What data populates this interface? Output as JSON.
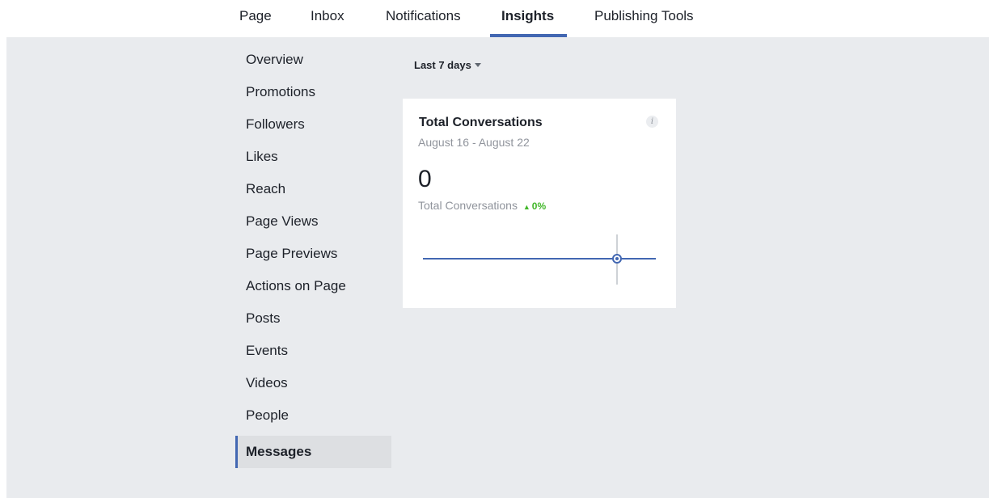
{
  "nav": {
    "tabs": [
      {
        "label": "Page"
      },
      {
        "label": "Inbox"
      },
      {
        "label": "Notifications"
      },
      {
        "label": "Insights"
      },
      {
        "label": "Publishing Tools"
      }
    ],
    "active": "Insights"
  },
  "sidebar": {
    "items": [
      {
        "label": "Overview"
      },
      {
        "label": "Promotions"
      },
      {
        "label": "Followers"
      },
      {
        "label": "Likes"
      },
      {
        "label": "Reach"
      },
      {
        "label": "Page Views"
      },
      {
        "label": "Page Previews"
      },
      {
        "label": "Actions on Page"
      },
      {
        "label": "Posts"
      },
      {
        "label": "Events"
      },
      {
        "label": "Videos"
      },
      {
        "label": "People"
      },
      {
        "label": "Messages"
      }
    ],
    "active": "Messages"
  },
  "filter": {
    "range_label": "Last 7 days"
  },
  "card": {
    "title": "Total Conversations",
    "date_range": "August 16 - August 22",
    "info_icon": "i",
    "value": "0",
    "metric_label": "Total Conversations",
    "change": "0%",
    "change_direction_icon": "▲"
  },
  "colors": {
    "accent": "#4267b2",
    "positive": "#42b72a",
    "background": "#e9ebee"
  },
  "chart_data": {
    "type": "line",
    "series": [
      {
        "values": [
          0,
          0,
          0,
          0,
          0,
          0,
          0
        ]
      }
    ],
    "highlight_index": 5,
    "xlabel": "",
    "ylabel": ""
  }
}
